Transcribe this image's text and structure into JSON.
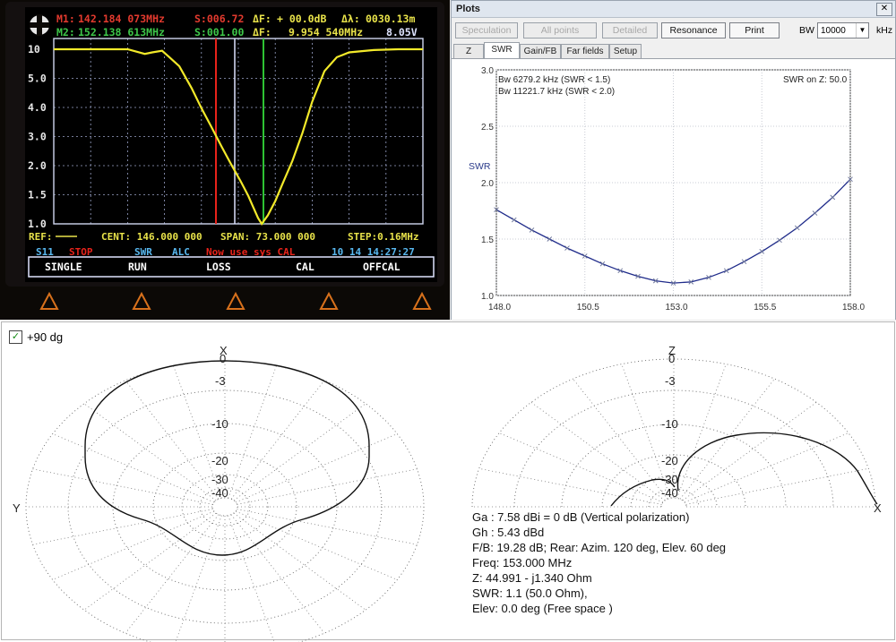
{
  "analyzer": {
    "m1_label": "M1:",
    "m1_freq": "142.184 073MHz",
    "m1_s": "S:006.72",
    "dF_label": "ΔF:",
    "dF_value": "+ 00.0dB",
    "lambda_label": "Δλ:",
    "lambda_value": "0030.13m",
    "m2_label": "M2:",
    "m2_freq": "152.138 613MHz",
    "m2_s": "S:001.00",
    "dF2_label": "ΔF:",
    "dF2_value": "9.954 540MHz",
    "voltage": "8.05V",
    "y_ticks": [
      "10",
      "5.0",
      "4.0",
      "3.0",
      "2.0",
      "1.5",
      "1.0"
    ],
    "ref_label": "REF:",
    "cent_label": "CENT: 146.000 000",
    "span_label": "SPAN: 73.000 000",
    "step_label": "STEP:0.16MHz",
    "mode": "S11",
    "stop": "STOP",
    "swr": "SWR",
    "alc": "ALC",
    "message": "Now use sys CAL",
    "datetime": "10 14 14:27:27",
    "softkeys": [
      "SINGLE",
      "RUN",
      "LOSS",
      "CAL",
      "OFFCAL"
    ],
    "colors": {
      "trace": "#f2e92a",
      "marker1": "#e8231b",
      "marker2": "#2ec233",
      "cursor": "#dde2ff"
    },
    "trace_points": [
      [
        0,
        10
      ],
      [
        0.2,
        10
      ],
      [
        0.3,
        10
      ],
      [
        0.37,
        9.4
      ],
      [
        0.4,
        9.6
      ],
      [
        0.44,
        9.8
      ],
      [
        0.47,
        9.0
      ],
      [
        0.51,
        8.0
      ],
      [
        0.56,
        6.0
      ],
      [
        0.6,
        4.6
      ],
      [
        0.64,
        3.6
      ],
      [
        0.68,
        2.8
      ],
      [
        0.72,
        2.2
      ],
      [
        0.76,
        1.75
      ],
      [
        0.79,
        1.45
      ],
      [
        0.81,
        1.25
      ],
      [
        0.83,
        1.08
      ],
      [
        0.845,
        1.0
      ],
      [
        0.87,
        1.12
      ],
      [
        0.9,
        1.35
      ],
      [
        0.93,
        1.7
      ],
      [
        0.97,
        2.3
      ],
      [
        1.01,
        3.3
      ],
      [
        1.05,
        5.0
      ],
      [
        1.1,
        7.5
      ],
      [
        1.15,
        9.0
      ],
      [
        1.2,
        9.6
      ],
      [
        1.3,
        9.9
      ],
      [
        1.4,
        10
      ],
      [
        1.5,
        10
      ]
    ]
  },
  "plots_window": {
    "title": "Plots",
    "close": "✕",
    "buttons": [
      {
        "label": "Speculation",
        "enabled": false
      },
      {
        "label": "All points",
        "enabled": false
      },
      {
        "label": "Detailed",
        "enabled": false
      },
      {
        "label": "Resonance",
        "enabled": true
      },
      {
        "label": "Print",
        "enabled": true
      }
    ],
    "bw_label": "BW",
    "bw_value": "10000",
    "bw_unit": "kHz",
    "tabs": [
      "Z",
      "SWR",
      "Gain/FB",
      "Far fields",
      "Setup"
    ],
    "active_tab": "SWR",
    "note1": "Bw 6279.2 kHz (SWR < 1.5)",
    "note2": "Bw 11221.7 kHz (SWR < 2.0)",
    "note_right": "SWR on Z: 50.0",
    "colors": {
      "curve": "#1f2b8a",
      "grid": "#cfd2d8"
    }
  },
  "chart_data": {
    "type": "line",
    "title": "",
    "xlabel": "",
    "ylabel": "SWR",
    "xlim": [
      148.0,
      158.0
    ],
    "ylim": [
      1.0,
      3.0
    ],
    "x_ticks": [
      "148.0",
      "150.5",
      "153.0",
      "155.5",
      "158.0"
    ],
    "y_ticks": [
      "1.0",
      "1.5",
      "2.0",
      "2.5",
      "3.0"
    ],
    "grid": true,
    "series": [
      {
        "x": [
          148.0,
          148.5,
          149.0,
          149.5,
          150.0,
          150.5,
          151.0,
          151.5,
          152.0,
          152.5,
          153.0,
          153.5,
          154.0,
          154.5,
          155.0,
          155.5,
          156.0,
          156.5,
          157.0,
          157.5,
          158.0
        ],
        "y": [
          1.76,
          1.67,
          1.58,
          1.5,
          1.42,
          1.35,
          1.28,
          1.22,
          1.17,
          1.13,
          1.11,
          1.12,
          1.16,
          1.22,
          1.3,
          1.39,
          1.49,
          1.6,
          1.73,
          1.87,
          2.03
        ]
      }
    ]
  },
  "pattern": {
    "checkbox_label": "+90 dg",
    "checkbox_mark": "✓",
    "left": {
      "axis_top": "X",
      "axis_left": "Y",
      "ring_labels": [
        "0",
        "-3",
        "-10",
        "-20",
        "-30",
        "-40"
      ]
    },
    "right": {
      "axis_top": "Z",
      "axis_right": "X",
      "ring_labels": [
        "0",
        "-3",
        "-10",
        "-20",
        "-30",
        "-40"
      ]
    },
    "info_lines": [
      "Ga : 7.58 dBi = 0 dB  (Vertical polarization)",
      "Gh : 5.43 dBd",
      "F/B: 19.28 dB; Rear: Azim. 120 deg,  Elev. 60 deg",
      "Freq: 153.000 MHz",
      "Z: 44.991 - j1.340 Ohm",
      "SWR: 1.1 (50.0 Ohm),",
      "Elev: 0.0 deg (Free space )"
    ]
  }
}
